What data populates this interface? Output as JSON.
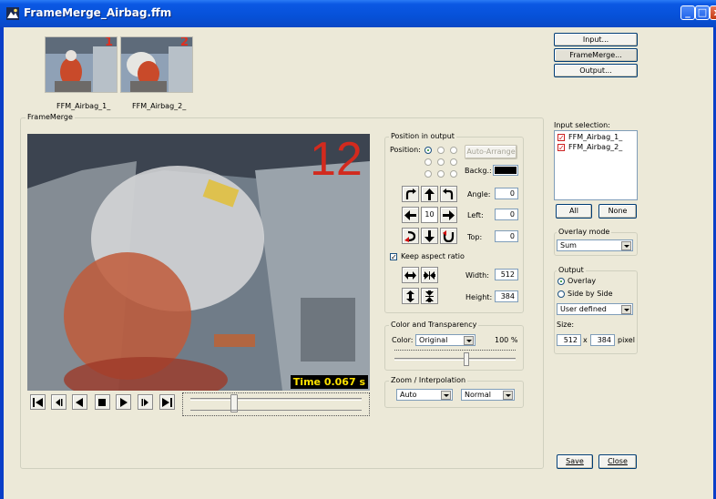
{
  "window": {
    "title": "FrameMerge_Airbag.ffm"
  },
  "thumbnails": [
    {
      "label": "FFM_Airbag_1_",
      "number": "1"
    },
    {
      "label": "FFM_Airbag_2_",
      "number": "2"
    }
  ],
  "top_buttons": {
    "input": "Input...",
    "framemerge": "FrameMerge...",
    "output": "Output..."
  },
  "framemerge_group": {
    "label": "FrameMerge"
  },
  "video": {
    "frame_number": "12",
    "time_overlay": "Time 0.067 s"
  },
  "position_group": {
    "label": "Position in output",
    "position_label": "Position:",
    "auto_arrange": "Auto-Arrange",
    "backg_label": "Backg.:",
    "backg_color": "#000000",
    "step_value": "10",
    "angle_label": "Angle:",
    "angle_value": "0",
    "left_label": "Left:",
    "left_value": "0",
    "top_label": "Top:",
    "top_value": "0",
    "keep_aspect_label": "Keep aspect ratio",
    "keep_aspect_checked": true,
    "width_label": "Width:",
    "width_value": "512",
    "height_label": "Height:",
    "height_value": "384"
  },
  "color_group": {
    "label": "Color and Transparency",
    "color_label": "Color:",
    "color_value": "Original",
    "transparency_value": "100 %",
    "transparency_slider": 0.6
  },
  "zoom_group": {
    "label": "Zoom / Interpolation",
    "zoom_value": "Auto",
    "interp_value": "Normal"
  },
  "input_selection": {
    "label": "Input selection:",
    "items": [
      {
        "label": "FFM_Airbag_1_",
        "checked": true
      },
      {
        "label": "FFM_Airbag_2_",
        "checked": true
      }
    ],
    "all_button": "All",
    "none_button": "None"
  },
  "overlay_mode": {
    "label": "Overlay mode",
    "value": "Sum"
  },
  "output_group": {
    "label": "Output",
    "overlay_option": "Overlay",
    "side_option": "Side by Side",
    "selected": "Overlay",
    "size_preset": "User defined",
    "size_label": "Size:",
    "width": "512",
    "x_label": "x",
    "height": "384",
    "unit": "pixel"
  },
  "footer_buttons": {
    "save": "Save",
    "close": "Close"
  },
  "playback": {
    "position": 0.24
  },
  "colors": {
    "accent_red": "#e03020",
    "titlebar": "#0a58e4"
  }
}
